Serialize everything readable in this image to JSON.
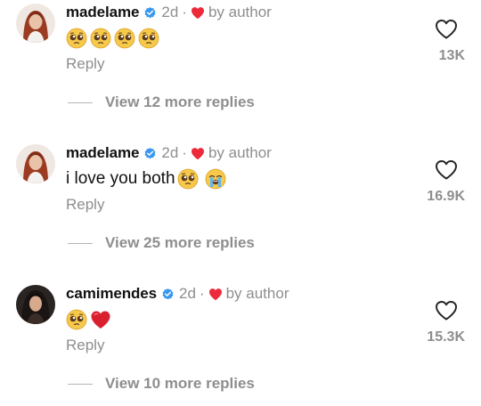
{
  "comments": [
    {
      "username": "madelame",
      "time": "2d",
      "separator": "·",
      "by_author": "by author",
      "text": "",
      "emojis": [
        "pleading-face-emoji",
        "pleading-face-emoji",
        "pleading-face-emoji",
        "pleading-face-emoji"
      ],
      "reply_label": "Reply",
      "like_count": "13K",
      "view_replies": "View 12 more replies"
    },
    {
      "username": "madelame",
      "time": "2d",
      "separator": "·",
      "by_author": "by author",
      "text": "i love you both",
      "emojis": [
        "pleading-face-emoji",
        "loudly-crying-face-emoji"
      ],
      "reply_label": "Reply",
      "like_count": "16.9K",
      "view_replies": "View 25 more replies"
    },
    {
      "username": "camimendes",
      "time": "2d",
      "separator": "·",
      "by_author": "by author",
      "text": "",
      "emojis": [
        "pleading-face-emoji",
        "red-heart-emoji"
      ],
      "reply_label": "Reply",
      "like_count": "15.3K",
      "view_replies": "View 10 more replies"
    }
  ],
  "colors": {
    "username": "#111111",
    "muted": "#8e8e8e",
    "verified": "#3897f0",
    "heart": "#ed2a3a"
  },
  "icons": {
    "verified": "verified-badge-icon",
    "liked_by_author": "heart-icon",
    "like": "heart-outline-icon"
  }
}
